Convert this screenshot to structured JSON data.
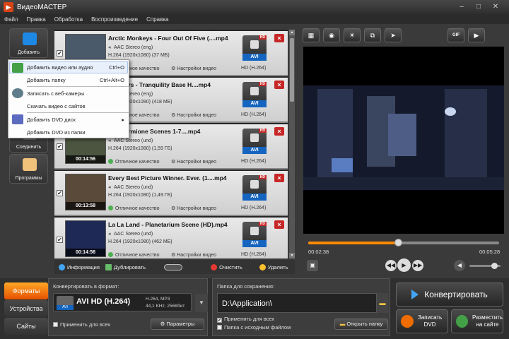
{
  "window": {
    "title": "ВидеоМАСТЕР",
    "minimize": "–",
    "maximize": "□",
    "close": "✕"
  },
  "menu": [
    "Файл",
    "Правка",
    "Обработка",
    "Воспроизведение",
    "Справка"
  ],
  "left": {
    "add": "Добавить",
    "join": "Соединить",
    "programs": "Программы"
  },
  "dropdown": [
    {
      "label": "Добавить видео или аудио",
      "shortcut": "Ctrl+O"
    },
    {
      "label": "Добавить папку",
      "shortcut": "Ctrl+Alt+O"
    },
    {
      "label": "Записать с веб-камеры",
      "shortcut": ""
    },
    {
      "label": "Скачать видео с сайтов",
      "shortcut": ""
    },
    {
      "label": "Добавить DVD диск",
      "shortcut": "▸"
    },
    {
      "label": "Добавить DVD из папки",
      "shortcut": ""
    }
  ],
  "files": [
    {
      "title": "Arctic Monkeys - Four Out Of Five (....mp4",
      "audio": "AAC Stereo (eng)",
      "video": "H.264 (1920x1080) (37 МБ)",
      "quality": "Отличное качество",
      "settings": "Настройки видео",
      "codec": "HD (H.264)",
      "format": "AVI",
      "badge": "HD",
      "duration": "",
      "thumb": "#4a5a6a"
    },
    {
      "title": "Monkeys - Tranquility Base H....mp4",
      "audio": "AAC Stereo (eng)",
      "video": "H.264 (1920x1080) (418 МБ)",
      "quality": "Отличное качество",
      "settings": "Настройки видео",
      "codec": "HD (H.264)",
      "format": "AVI",
      "badge": "HD",
      "duration": "",
      "thumb": "#55504a"
    },
    {
      "title": "and Hermione Scenes 1-7....mp4",
      "audio": "AAC Stereo (und)",
      "video": "H.264 (1920x1080) (1,59 ГБ)",
      "quality": "Отличное качество",
      "settings": "Настройки видео",
      "codec": "HD (H.264)",
      "format": "AVI",
      "badge": "HD",
      "duration": "",
      "thumb": "#4b5540"
    },
    {
      "title": "Every Best Picture Winner. Ever. (1....mp4",
      "audio": "AAC Stereo (und)",
      "video": "H.264 (1920x1080) (1,49 ГБ)",
      "quality": "Отличное качество",
      "settings": "Настройки видео",
      "codec": "HD (H.264)",
      "format": "AVI",
      "badge": "HD",
      "duration": "00:13:58",
      "thumb": "#5a4a3a"
    },
    {
      "title": "La La Land - Planetarium Scene (HD).mp4",
      "audio": "AAC Stereo (und)",
      "video": "H.264 (1920x1080) (462 МБ)",
      "quality": "Отличное качество",
      "settings": "Настройки видео",
      "codec": "HD (H.264)",
      "format": "AVI",
      "badge": "HD",
      "duration": "00:14:56",
      "thumb": "#1e2a55"
    }
  ],
  "file_durations_extra": {
    "row3": "00:14:56"
  },
  "listbar": {
    "info": "Информация",
    "dup": "Дублировать",
    "clear": "Очистить",
    "delete": "Удалить"
  },
  "player": {
    "current": "00:02:38",
    "total": "00:05:28",
    "progress": 0.47,
    "volume": 0.8
  },
  "tabs": [
    "Форматы",
    "Устройства",
    "Сайты"
  ],
  "format": {
    "label": "Конвертировать в формат:",
    "name": "AVI HD (H.264)",
    "badge": "AVI",
    "spec1": "H.264, MP3",
    "spec2": "44,1 KHz, 256Кбит",
    "apply_all": "Применить для всех",
    "params": "Параметры"
  },
  "save": {
    "label": "Папка для сохранения:",
    "path": "D:\\Application\\",
    "apply_all": "Применить для всех",
    "source_folder": "Папка с исходным файлом",
    "open_folder": "Открыть папку"
  },
  "actions": {
    "convert": "Конвертировать",
    "burn_line1": "Записать",
    "burn_line2": "DVD",
    "publish_line1": "Разместить",
    "publish_line2": "на сайте"
  },
  "colors": {
    "accent": "#ff8a00",
    "delete": "#c62828",
    "avi": "#1565c0"
  }
}
